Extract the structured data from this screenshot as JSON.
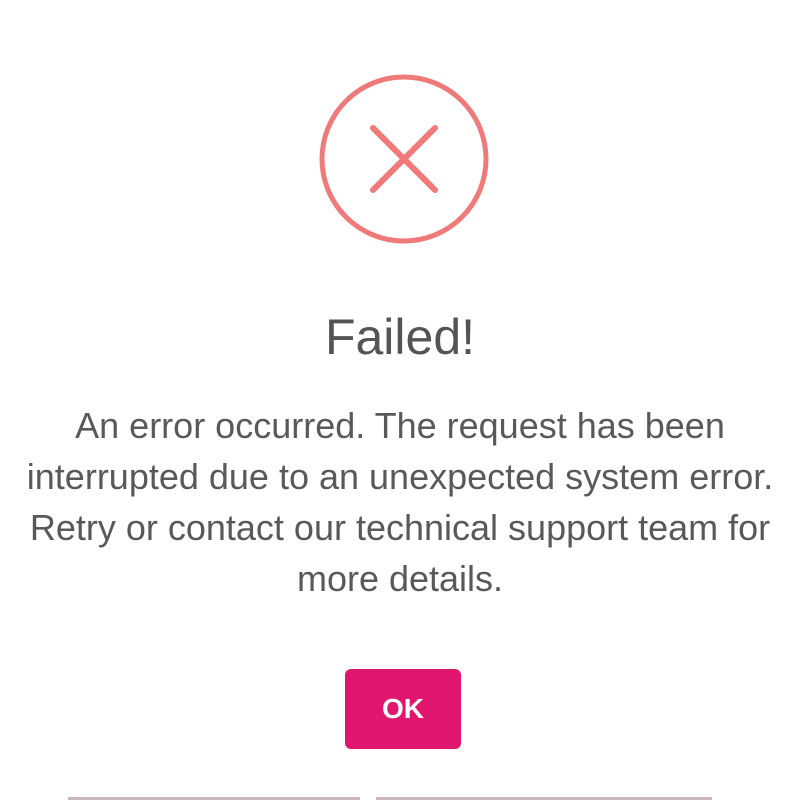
{
  "dialog": {
    "icon": "error-x-circle-icon",
    "title": "Failed!",
    "message": "An error occurred. The request has been interrupted due to an unexpected system error. Retry or contact our technical support team for more details.",
    "ok_label": "OK"
  },
  "colors": {
    "error": "#f07a7a",
    "title_text": "#545454",
    "message_text": "#595959",
    "button_bg": "#e0166f",
    "button_text": "#ffffff"
  }
}
